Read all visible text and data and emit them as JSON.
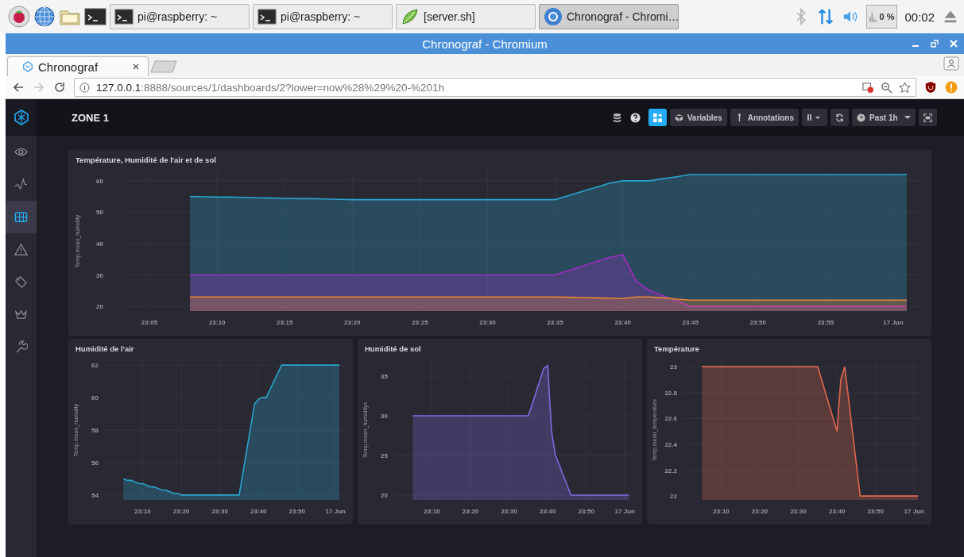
{
  "taskbar": {
    "tasks": [
      {
        "kind": "terminal",
        "label": "pi@raspberry: ~",
        "selected": false
      },
      {
        "kind": "terminal",
        "label": "pi@raspberry: ~",
        "selected": false
      },
      {
        "kind": "editor",
        "label": "[server.sh]",
        "selected": false
      },
      {
        "kind": "browser",
        "label": "Chronograf - Chromi…",
        "selected": true
      }
    ],
    "cpu": "0 %",
    "clock": "00:02"
  },
  "window": {
    "title": "Chronograf - Chromium"
  },
  "browser": {
    "tabs": [
      {
        "label": "Chronograf",
        "selected": true
      }
    ],
    "back_disabled": false,
    "forward_disabled": true,
    "url_host": "127.0.0.1",
    "url_path": ":8888/sources/1/dashboards/2?lower=now%28%29%20-%201h"
  },
  "sidebar": {
    "items": [
      {
        "selected": false
      },
      {
        "selected": false
      },
      {
        "selected": true
      },
      {
        "selected": false
      },
      {
        "selected": false
      },
      {
        "selected": false
      },
      {
        "selected": false
      }
    ]
  },
  "dashboard": {
    "title": "ZONE 1",
    "buttons": [
      {
        "label": "Variables"
      },
      {
        "label": "Annotations"
      }
    ],
    "time_range": "Past 1h",
    "cells": [
      {
        "title": "Température, Humidité de l'air et de sol",
        "chart_data": {
          "type": "area",
          "grid": true,
          "ylabel": "Temp.mean_humidity",
          "ylim": [
            18.5,
            63
          ],
          "yticks": [
            20,
            30,
            40,
            50,
            60
          ],
          "categories": [
            null,
            null,
            "23:05",
            null,
            null,
            null,
            null,
            "23:10",
            null,
            null,
            null,
            null,
            "23:15",
            null,
            null,
            null,
            null,
            "23:20",
            null,
            null,
            null,
            null,
            "23:25",
            null,
            null,
            null,
            null,
            "23:30",
            null,
            null,
            null,
            null,
            "23:35",
            null,
            null,
            null,
            null,
            "23:40",
            null,
            null,
            null,
            null,
            "23:45",
            null,
            null,
            null,
            null,
            "23:50",
            null,
            null,
            null,
            null,
            "23:55",
            null,
            null,
            null,
            null,
            "17 Jun",
            null,
            null
          ],
          "series": [
            {
              "color": "#2aa4cc",
              "values": [
                null,
                null,
                null,
                null,
                null,
                55,
                54.9,
                54.8,
                54.8,
                54.7,
                54.6,
                54.5,
                54.4,
                54.3,
                54.3,
                54.2,
                54.1,
                54,
                54,
                54,
                54,
                54,
                54,
                54,
                54,
                54,
                54,
                54,
                54,
                54,
                54,
                54,
                54,
                55.3,
                56.6,
                57.9,
                59.2,
                60,
                60,
                60,
                60.7,
                61.3,
                62,
                62,
                62,
                62,
                62,
                62,
                62,
                62,
                62,
                62,
                62,
                62,
                62,
                62,
                62,
                62,
                62,
                null
              ]
            },
            {
              "color": "#a12cc4",
              "values": [
                null,
                null,
                null,
                null,
                null,
                30,
                30,
                30,
                30,
                30,
                30,
                30,
                30,
                30,
                30,
                30,
                30,
                30,
                30,
                30,
                30,
                30,
                30,
                30,
                30,
                30,
                30,
                30,
                30,
                30,
                30,
                30,
                30,
                31.4,
                32.8,
                34.2,
                35.6,
                36.5,
                28,
                25,
                23.3,
                21.7,
                20,
                20,
                20,
                20,
                20,
                20,
                20,
                20,
                20,
                20,
                20,
                20,
                20,
                20,
                20,
                20,
                20,
                null
              ]
            },
            {
              "color": "#ec8634",
              "values": [
                null,
                null,
                null,
                null,
                null,
                23,
                23,
                23,
                23,
                23,
                23,
                23,
                23,
                23,
                23,
                23,
                23,
                23,
                23,
                23,
                23,
                23,
                23,
                23,
                23,
                23,
                23,
                23,
                23,
                23,
                23,
                23,
                23,
                22.9,
                22.8,
                22.7,
                22.6,
                22.5,
                23,
                23,
                22.7,
                22.3,
                22,
                22,
                22,
                22,
                22,
                22,
                22,
                22,
                22,
                22,
                22,
                22,
                22,
                22,
                22,
                22,
                22,
                null
              ]
            }
          ]
        }
      },
      {
        "title": "Humidité de l'air",
        "chart_data": {
          "type": "area",
          "grid": true,
          "ylabel": "Temp.mean_humidity",
          "ylim": [
            53.7,
            62.3
          ],
          "yticks": [
            54,
            56,
            58,
            60,
            62
          ],
          "categories": [
            null,
            null,
            null,
            null,
            null,
            null,
            null,
            null,
            null,
            null,
            "23:10",
            null,
            null,
            null,
            null,
            null,
            null,
            null,
            null,
            null,
            "23:20",
            null,
            null,
            null,
            null,
            null,
            null,
            null,
            null,
            null,
            "23:30",
            null,
            null,
            null,
            null,
            null,
            null,
            null,
            null,
            null,
            "23:40",
            null,
            null,
            null,
            null,
            null,
            null,
            null,
            null,
            null,
            "23:50",
            null,
            null,
            null,
            null,
            null,
            null,
            null,
            null,
            null,
            "17 Jun",
            null,
            null
          ],
          "series": [
            {
              "color": "#2aa4cc",
              "values": [
                null,
                null,
                null,
                null,
                null,
                55,
                54.9,
                54.9,
                54.8,
                54.7,
                54.7,
                54.6,
                54.5,
                54.5,
                54.4,
                54.3,
                54.3,
                54.2,
                54.1,
                54.1,
                54,
                54,
                54,
                54,
                54,
                54,
                54,
                54,
                54,
                54,
                54,
                54,
                54,
                54,
                54,
                54,
                55.4,
                56.8,
                58.2,
                59.6,
                59.9,
                60,
                60,
                60.5,
                61,
                61.5,
                62,
                62,
                62,
                62,
                62,
                62,
                62,
                62,
                62,
                62,
                62,
                62,
                62,
                62,
                62,
                62,
                null
              ]
            }
          ]
        }
      },
      {
        "title": "Humidité de sol",
        "chart_data": {
          "type": "area",
          "grid": true,
          "ylabel": "Temp.mean_humiditys",
          "ylim": [
            19.4,
            37
          ],
          "yticks": [
            20,
            25,
            30,
            35
          ],
          "categories": [
            null,
            null,
            null,
            null,
            null,
            null,
            null,
            null,
            null,
            null,
            "23:10",
            null,
            null,
            null,
            null,
            null,
            null,
            null,
            null,
            null,
            "23:20",
            null,
            null,
            null,
            null,
            null,
            null,
            null,
            null,
            null,
            "23:30",
            null,
            null,
            null,
            null,
            null,
            null,
            null,
            null,
            null,
            "23:40",
            null,
            null,
            null,
            null,
            null,
            null,
            null,
            null,
            null,
            "23:50",
            null,
            null,
            null,
            null,
            null,
            null,
            null,
            null,
            null,
            "17 Jun",
            null,
            null
          ],
          "series": [
            {
              "color": "#7b6ce0",
              "values": [
                null,
                null,
                null,
                null,
                null,
                30,
                30,
                30,
                30,
                30,
                30,
                30,
                30,
                30,
                30,
                30,
                30,
                30,
                30,
                30,
                30,
                30,
                30,
                30,
                30,
                30,
                30,
                30,
                30,
                30,
                30,
                30,
                30,
                30,
                30,
                30,
                31.5,
                33,
                34.5,
                36,
                36.3,
                28,
                25,
                23.8,
                22.5,
                21.3,
                20,
                20,
                20,
                20,
                20,
                20,
                20,
                20,
                20,
                20,
                20,
                20,
                20,
                20,
                20,
                20,
                null
              ]
            }
          ]
        }
      },
      {
        "title": "Température",
        "chart_data": {
          "type": "area",
          "grid": true,
          "ylabel": "Temp.mean_temperature",
          "ylim": [
            21.97,
            23.05
          ],
          "yticks": [
            22,
            22.2,
            22.4,
            22.6,
            22.8,
            23
          ],
          "categories": [
            null,
            null,
            null,
            null,
            null,
            null,
            null,
            null,
            null,
            null,
            "23:10",
            null,
            null,
            null,
            null,
            null,
            null,
            null,
            null,
            null,
            "23:20",
            null,
            null,
            null,
            null,
            null,
            null,
            null,
            null,
            null,
            "23:30",
            null,
            null,
            null,
            null,
            null,
            null,
            null,
            null,
            null,
            "23:40",
            null,
            null,
            null,
            null,
            null,
            null,
            null,
            null,
            null,
            "23:50",
            null,
            null,
            null,
            null,
            null,
            null,
            null,
            null,
            null,
            "17 Jun",
            null,
            null
          ],
          "series": [
            {
              "color": "#e0674f",
              "values": [
                null,
                null,
                null,
                null,
                null,
                23,
                23,
                23,
                23,
                23,
                23,
                23,
                23,
                23,
                23,
                23,
                23,
                23,
                23,
                23,
                23,
                23,
                23,
                23,
                23,
                23,
                23,
                23,
                23,
                23,
                23,
                23,
                23,
                23,
                23,
                23,
                22.9,
                22.8,
                22.7,
                22.6,
                22.5,
                22.9,
                23,
                22.75,
                22.5,
                22.25,
                22,
                22,
                22,
                22,
                22,
                22,
                22,
                22,
                22,
                22,
                22,
                22,
                22,
                22,
                22,
                22,
                null
              ]
            }
          ]
        }
      }
    ]
  }
}
